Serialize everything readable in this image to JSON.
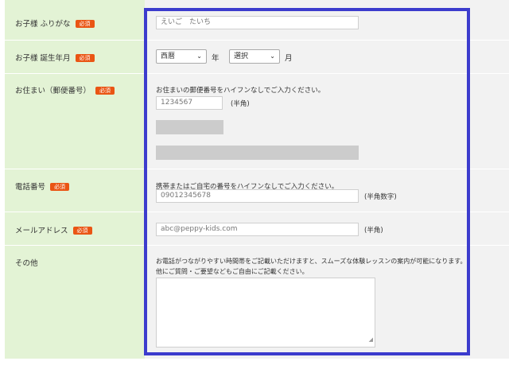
{
  "required_badge": "必須",
  "rows": {
    "kana": {
      "label": "お子様 ふりがな",
      "placeholder": "えいご　たいち"
    },
    "birth": {
      "label": "お子様 誕生年月",
      "era_select": "西暦",
      "year_suffix": "年",
      "month_select": "選択",
      "month_suffix": "月"
    },
    "address": {
      "label": "お住まい（郵便番号）",
      "instruction": "お住まいの郵便番号をハイフンなしでご入力ください。",
      "placeholder": "1234567",
      "note": "(半角)"
    },
    "phone": {
      "label": "電話番号",
      "instruction": "携帯またはご自宅の番号をハイフンなしでご入力ください。",
      "placeholder": "09012345678",
      "note": "(半角数字)"
    },
    "email": {
      "label": "メールアドレス",
      "placeholder": "abc@peppy-kids.com",
      "note": "(半角)"
    },
    "other": {
      "label": "その他",
      "instruction_1": "お電話がつながりやすい時間帯をご記載いただけますと、スムーズな体験レッスンの案内が可能になります。",
      "instruction_2": "他にご質問・ご要望などもご自由にご記載ください。"
    }
  },
  "colors": {
    "label_bg": "#e3f3d5",
    "field_bg": "#f2f2f2",
    "required_badge": "#ea5514",
    "highlight_frame": "#3c3ccd"
  }
}
